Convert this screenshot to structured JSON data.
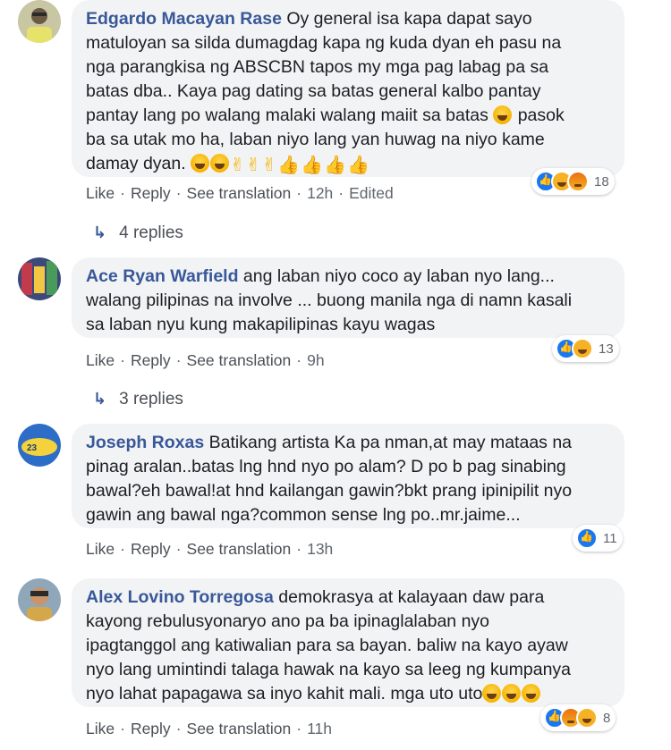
{
  "actions": {
    "like": "Like",
    "reply": "Reply",
    "see_translation": "See translation",
    "sep": "·"
  },
  "comments": [
    {
      "author": "Edgardo Macayan Rase",
      "text_lines": [
        "Oy general isa kapa dapat sayo",
        "matuloyan sa silda dumagdag kapa ng kuda dyan eh pasu na",
        "nga parangkisa ng ABSCBN tapos my mga pag labag pa sa",
        "batas dba.. Kaya pag dating sa batas general kalbo pantay",
        "pantay lang po walang malaki walang maiit sa batas",
        "pasok",
        "ba sa utak mo ha, laban niyo lang yan huwag na niyo kame",
        "damay dyan."
      ],
      "time": "12h",
      "edited": "Edited",
      "reaction_count": "18",
      "reaction_icons": [
        "like-icon",
        "haha-icon",
        "angry-icon"
      ],
      "replies_label": "4 replies"
    },
    {
      "author": "Ace Ryan Warfield",
      "text_lines": [
        "ang laban niyo coco ay laban nyo lang...",
        "walang pilipinas na involve ... buong manila nga di namn kasali",
        "sa laban nyu kung makapilipinas kayu wagas"
      ],
      "time": "9h",
      "reaction_count": "13",
      "reaction_icons": [
        "like-icon",
        "haha-icon"
      ],
      "replies_label": "3 replies"
    },
    {
      "author": "Joseph Roxas",
      "text_lines": [
        "Batikang artista Ka pa nman,at may mataas na",
        "pinag aralan..batas lng hnd nyo po alam? D po b pag sinabing",
        "bawal?eh bawal!at hnd kailangan gawin?bkt prang ipinipilit nyo",
        "gawin ang bawal nga?common sense lng po..mr.jaime..."
      ],
      "time": "13h",
      "reaction_count": "11",
      "reaction_icons": [
        "like-icon"
      ]
    },
    {
      "author": "Alex Lovino Torregosa",
      "text_lines": [
        "demokrasya at kalayaan daw para",
        "kayong rebulusyonaryo ano pa ba ipinaglalaban nyo",
        "ipagtanggol ang katiwalian para sa bayan. baliw na kayo ayaw",
        "nyo lang umintindi talaga hawak na kayo sa leeg ng kumpanya",
        "nyo lahat papagawa sa inyo kahit mali. mga uto uto"
      ],
      "time": "11h",
      "reaction_count": "8",
      "reaction_icons": [
        "like-icon",
        "angry-icon",
        "haha-icon"
      ]
    }
  ]
}
